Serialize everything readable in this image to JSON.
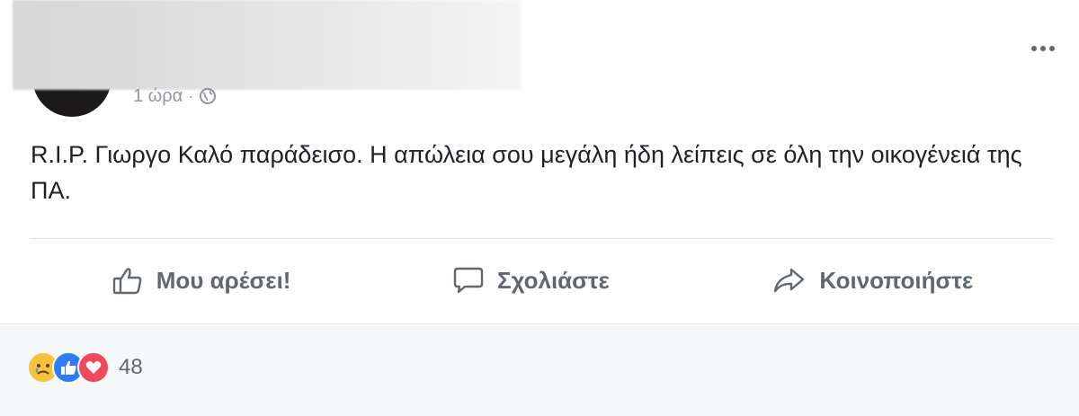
{
  "post": {
    "timestamp": "1 ώρα",
    "separator": "·",
    "privacy_icon": "globe-icon",
    "text": "R.I.P. Γιωργο Καλό παράδεισο. Η απώλεια σου μεγάλη ήδη λείπεις σε όλη την οικογένειά της ΠΑ."
  },
  "actions": {
    "like_label": "Μου αρέσει!",
    "comment_label": "Σχολιάστε",
    "share_label": "Κοινοποιήστε"
  },
  "reactions": {
    "icons": [
      "sad-reaction-icon",
      "like-reaction-icon",
      "love-reaction-icon"
    ],
    "count": "48"
  },
  "colors": {
    "text": "#1d2129",
    "secondary": "#606770",
    "meta": "#90949c",
    "like_blue": "#2e7cf6",
    "love_red": "#f0485c",
    "sad_yellow": "#f7c23a"
  }
}
